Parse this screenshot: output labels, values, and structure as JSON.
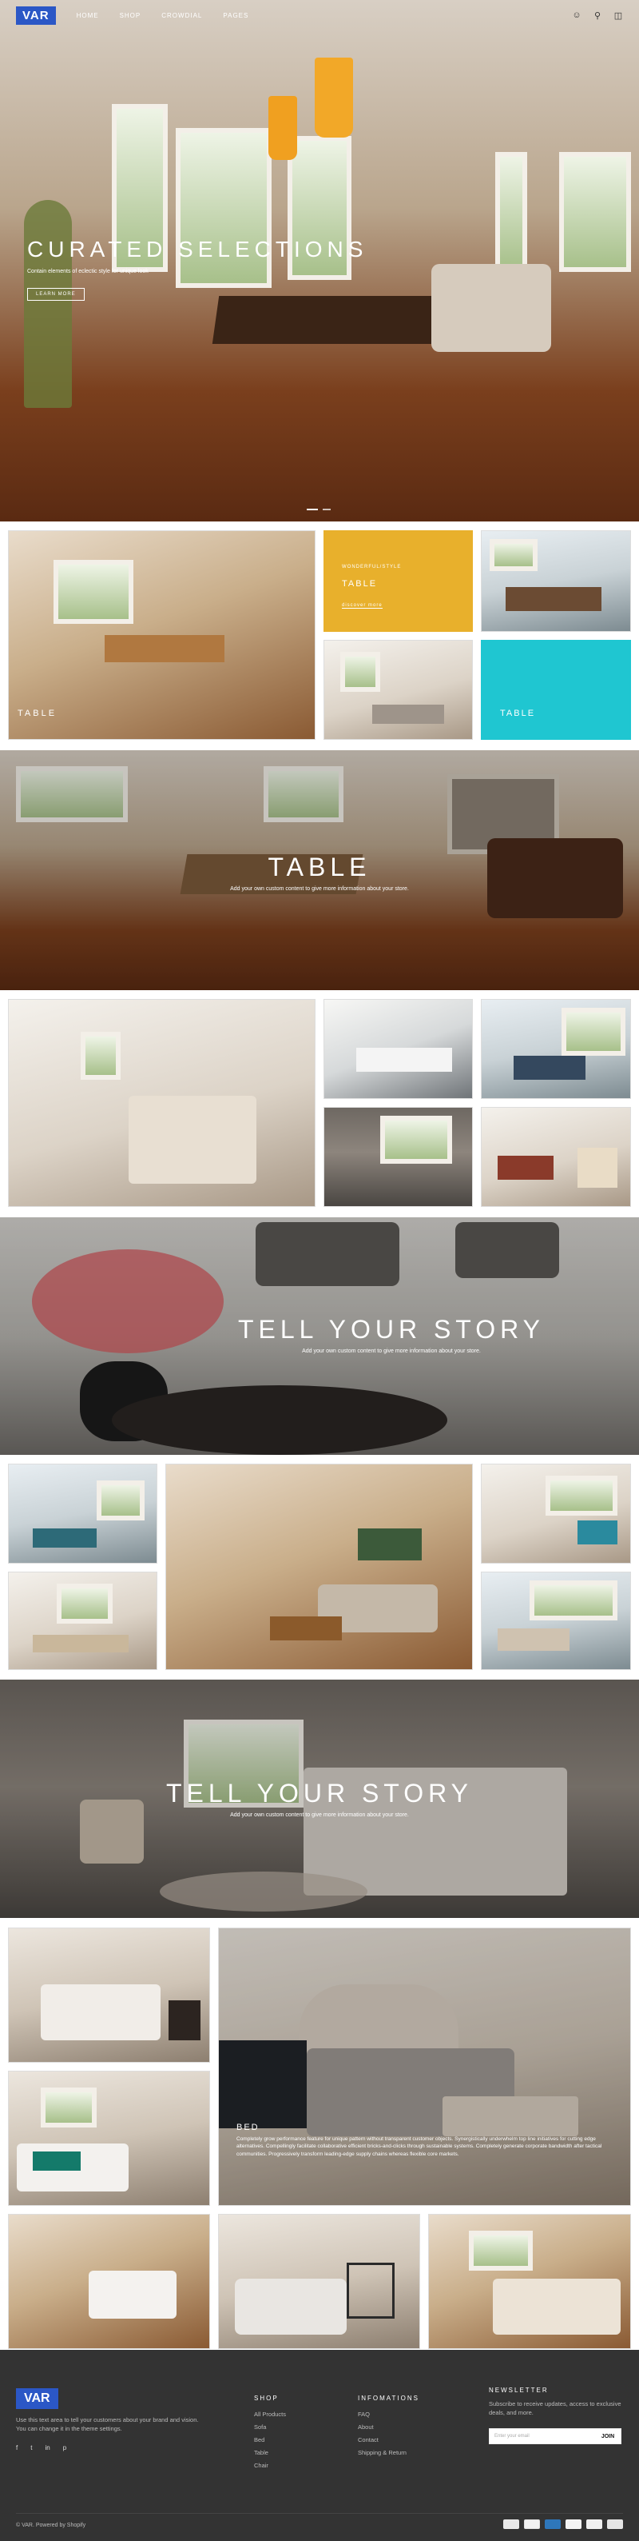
{
  "header": {
    "logo": "VAR",
    "nav": [
      "HOME",
      "SHOP",
      "CROWDIAL",
      "PAGES"
    ],
    "icons": [
      "user-icon",
      "search-icon",
      "cart-icon"
    ]
  },
  "hero": {
    "title": "CURATED SELECTIONS",
    "subtitle": "Contain elements of eclectic style for unique look",
    "button": "LEARN MORE",
    "slides": 2
  },
  "collage1": {
    "tile_label_left": "TABLE",
    "promo_yellow_small": "WONDERFUL/STYLE",
    "promo_yellow_title": "TABLE",
    "promo_yellow_link": "discover more",
    "promo_cyan_title": "TABLE"
  },
  "banner_table": {
    "title": "TABLE",
    "subtitle": "Add your own custom content to give more information about your store."
  },
  "banner_story1": {
    "title": "TELL YOUR STORY",
    "subtitle": "Add your own custom content to give more information about your store."
  },
  "banner_story2": {
    "title": "TELL YOUR STORY",
    "subtitle": "Add your own custom content to give more information about your store."
  },
  "bed_feature": {
    "title": "BED",
    "text": "Completely grow performance feature for unique pattern without transparent customer objects. Synergistically underwhelm top line initiatives for cutting edge alternatives. Compellingly facilitate collaborative efficient bricks-and-clicks through sustainable systems. Completely generate corporate bandwidth after tactical communities. Progressively transform leading-edge supply chains whereas flexible core markets."
  },
  "footer": {
    "logo": "VAR",
    "description": "Use this text area to tell your customers about your brand and vision. You can change it in the theme settings.",
    "social": [
      "f",
      "t",
      "in",
      "p"
    ],
    "shop_heading": "SHOP",
    "shop_links": [
      "All Products",
      "Sofa",
      "Bed",
      "Table",
      "Chair"
    ],
    "info_heading": "INFOMATIONS",
    "info_links": [
      "FAQ",
      "About",
      "Contact",
      "Shipping & Return"
    ],
    "newsletter_heading": "NEWSLETTER",
    "newsletter_text": "Subscribe to receive updates, access to exclusive deals, and more.",
    "email_placeholder": "Enter your email",
    "join_label": "JOIN",
    "copyright": "© VAR. Powered by Shopify",
    "payment_icons": [
      "paypal-icon",
      "mastercard-icon",
      "amex-icon",
      "visa-icon",
      "discover-icon",
      "card-icon"
    ]
  },
  "colors": {
    "brand_blue": "#2b57c6",
    "promo_yellow": "#e8b02c",
    "promo_cyan": "#1fc6d1",
    "footer_bg": "#333333"
  }
}
